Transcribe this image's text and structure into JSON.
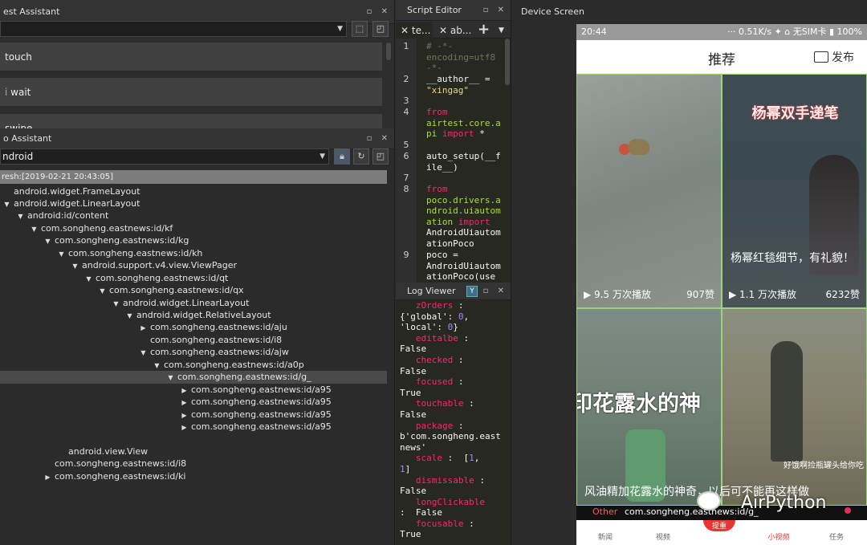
{
  "airtest": {
    "title": "est Assistant",
    "commands": [
      "touch",
      "wait",
      "swipe"
    ]
  },
  "poco": {
    "title": "o Assistant",
    "mode": "ndroid",
    "refresh": "resh:[2019-02-21 20:43:05]",
    "tree": [
      {
        "label": "android.widget.FrameLayout",
        "indent": 0,
        "arrow": ""
      },
      {
        "label": "android.widget.LinearLayout",
        "indent": 0,
        "arrow": "▼"
      },
      {
        "label": "android:id/content",
        "indent": 1,
        "arrow": "▼"
      },
      {
        "label": "com.songheng.eastnews:id/kf",
        "indent": 2,
        "arrow": "▼"
      },
      {
        "label": "com.songheng.eastnews:id/kg",
        "indent": 3,
        "arrow": "▼"
      },
      {
        "label": "com.songheng.eastnews:id/kh",
        "indent": 4,
        "arrow": "▼"
      },
      {
        "label": "android.support.v4.view.ViewPager",
        "indent": 5,
        "arrow": "▼"
      },
      {
        "label": "com.songheng.eastnews:id/qt",
        "indent": 6,
        "arrow": "▼"
      },
      {
        "label": "com.songheng.eastnews:id/qx",
        "indent": 7,
        "arrow": "▼"
      },
      {
        "label": "android.widget.LinearLayout",
        "indent": 8,
        "arrow": "▼"
      },
      {
        "label": "android.widget.RelativeLayout",
        "indent": 9,
        "arrow": "▼"
      },
      {
        "label": "com.songheng.eastnews:id/aju",
        "indent": 10,
        "arrow": "▶"
      },
      {
        "label": "com.songheng.eastnews:id/i8",
        "indent": 10,
        "arrow": ""
      },
      {
        "label": "com.songheng.eastnews:id/ajw",
        "indent": 10,
        "arrow": "▼"
      },
      {
        "label": "com.songheng.eastnews:id/a0p",
        "indent": 11,
        "arrow": "▼"
      },
      {
        "label": "com.songheng.eastnews:id/g_",
        "indent": 12,
        "arrow": "▼",
        "selected": true
      },
      {
        "label": "com.songheng.eastnews:id/a95",
        "indent": 13,
        "arrow": "▶"
      },
      {
        "label": "com.songheng.eastnews:id/a95",
        "indent": 13,
        "arrow": "▶"
      },
      {
        "label": "com.songheng.eastnews:id/a95",
        "indent": 13,
        "arrow": "▶"
      },
      {
        "label": "com.songheng.eastnews:id/a95",
        "indent": 13,
        "arrow": "▶"
      },
      {
        "label": "",
        "indent": 0,
        "arrow": ""
      },
      {
        "label": "android.view.View",
        "indent": 4,
        "arrow": ""
      },
      {
        "label": "com.songheng.eastnews:id/i8",
        "indent": 3,
        "arrow": ""
      },
      {
        "label": "com.songheng.eastnews:id/ki",
        "indent": 3,
        "arrow": "▶"
      }
    ]
  },
  "editor": {
    "title": "Script Editor",
    "tabs": [
      "te...",
      "ab..."
    ],
    "add_label": "+",
    "line_numbers": [
      "1",
      "2",
      "3",
      "4",
      "5",
      "6",
      "7",
      "8",
      "9"
    ]
  },
  "log": {
    "title": "Log Viewer"
  },
  "device": {
    "title": "Device Screen",
    "status_time": "20:44",
    "status_right": "··· 0.51K/s  ✦ ⌂ 无SIM卡 ▮ 100%",
    "page_title": "推荐",
    "publish_label": "发布",
    "cells": [
      {
        "caption": "",
        "plays": "9.5 万次播放",
        "likes": "907赞"
      },
      {
        "caption": "杨幂双手递笔",
        "sub": "杨幂红毯细节，有礼貌！",
        "plays": "1.1 万次播放",
        "likes": "6232赞"
      },
      {
        "caption": "印花露水的神",
        "plays": "",
        "likes": ""
      },
      {
        "caption": "好饿啊捡瓶罐头给你吃",
        "plays": "",
        "likes": ""
      }
    ],
    "bottom_caption": "风油精加花露水的神奇，以后可不能再这样做",
    "overlay_tag": "Other",
    "overlay_path": "com.songheng.eastnews:id/g_",
    "watermark": "AirPython",
    "nav": [
      "新闻",
      "视频",
      "提重",
      "小视频",
      "任务"
    ]
  }
}
